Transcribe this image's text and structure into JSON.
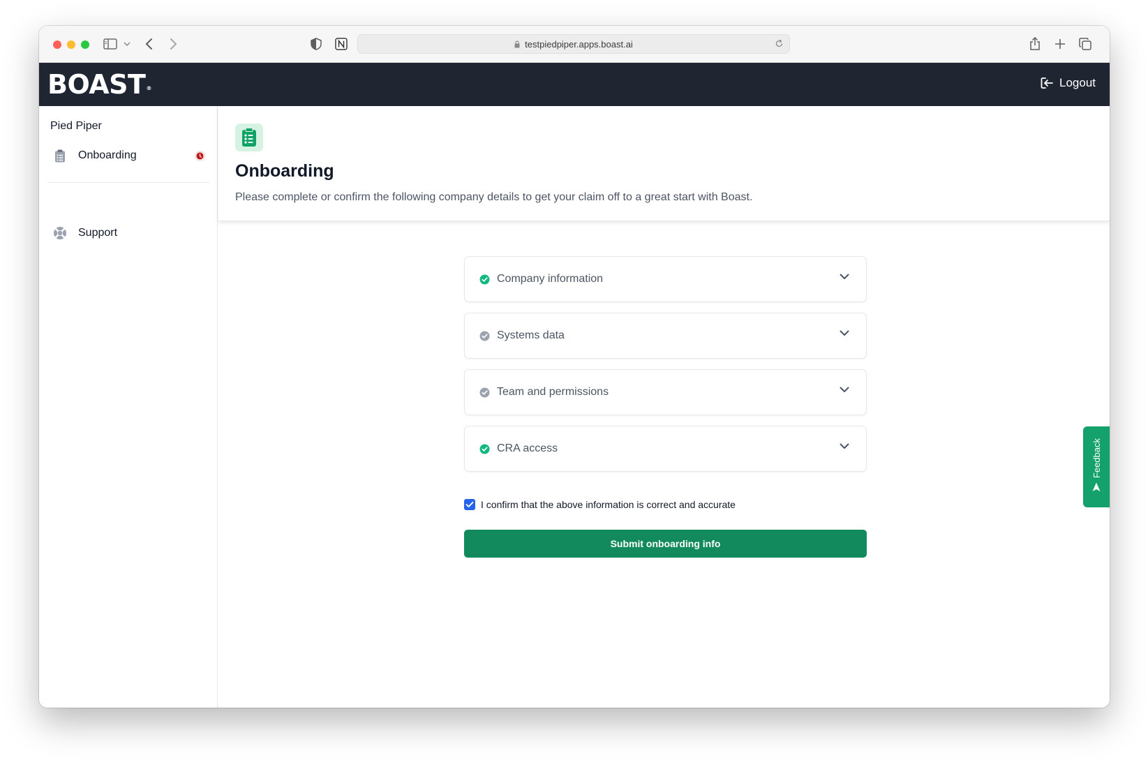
{
  "browser": {
    "url": "testpiedpiper.apps.boast.ai"
  },
  "header": {
    "logo_text": "BOAST",
    "logo_mark": "®",
    "logout_label": "Logout"
  },
  "sidebar": {
    "company_name": "Pied Piper",
    "items": [
      {
        "label": "Onboarding",
        "icon": "clipboard-list-icon"
      },
      {
        "label": "Support",
        "icon": "lifebuoy-icon"
      }
    ]
  },
  "page": {
    "title": "Onboarding",
    "subtitle": "Please complete or confirm the following company details to get your claim off to a great start with Boast."
  },
  "sections": [
    {
      "label": "Company information",
      "status": "complete"
    },
    {
      "label": "Systems data",
      "status": "incomplete"
    },
    {
      "label": "Team and permissions",
      "status": "incomplete"
    },
    {
      "label": "CRA access",
      "status": "complete"
    }
  ],
  "confirm": {
    "label": "I confirm that the above information is correct and accurate",
    "checked": true
  },
  "submit_label": "Submit onboarding info",
  "feedback_label": "Feedback",
  "colors": {
    "header_bg": "#1f2632",
    "brand_green": "#138a5e",
    "check_complete": "#10b981",
    "check_incomplete": "#9ca3af",
    "checkbox_blue": "#2563eb",
    "alert_red": "#b91c1c"
  }
}
